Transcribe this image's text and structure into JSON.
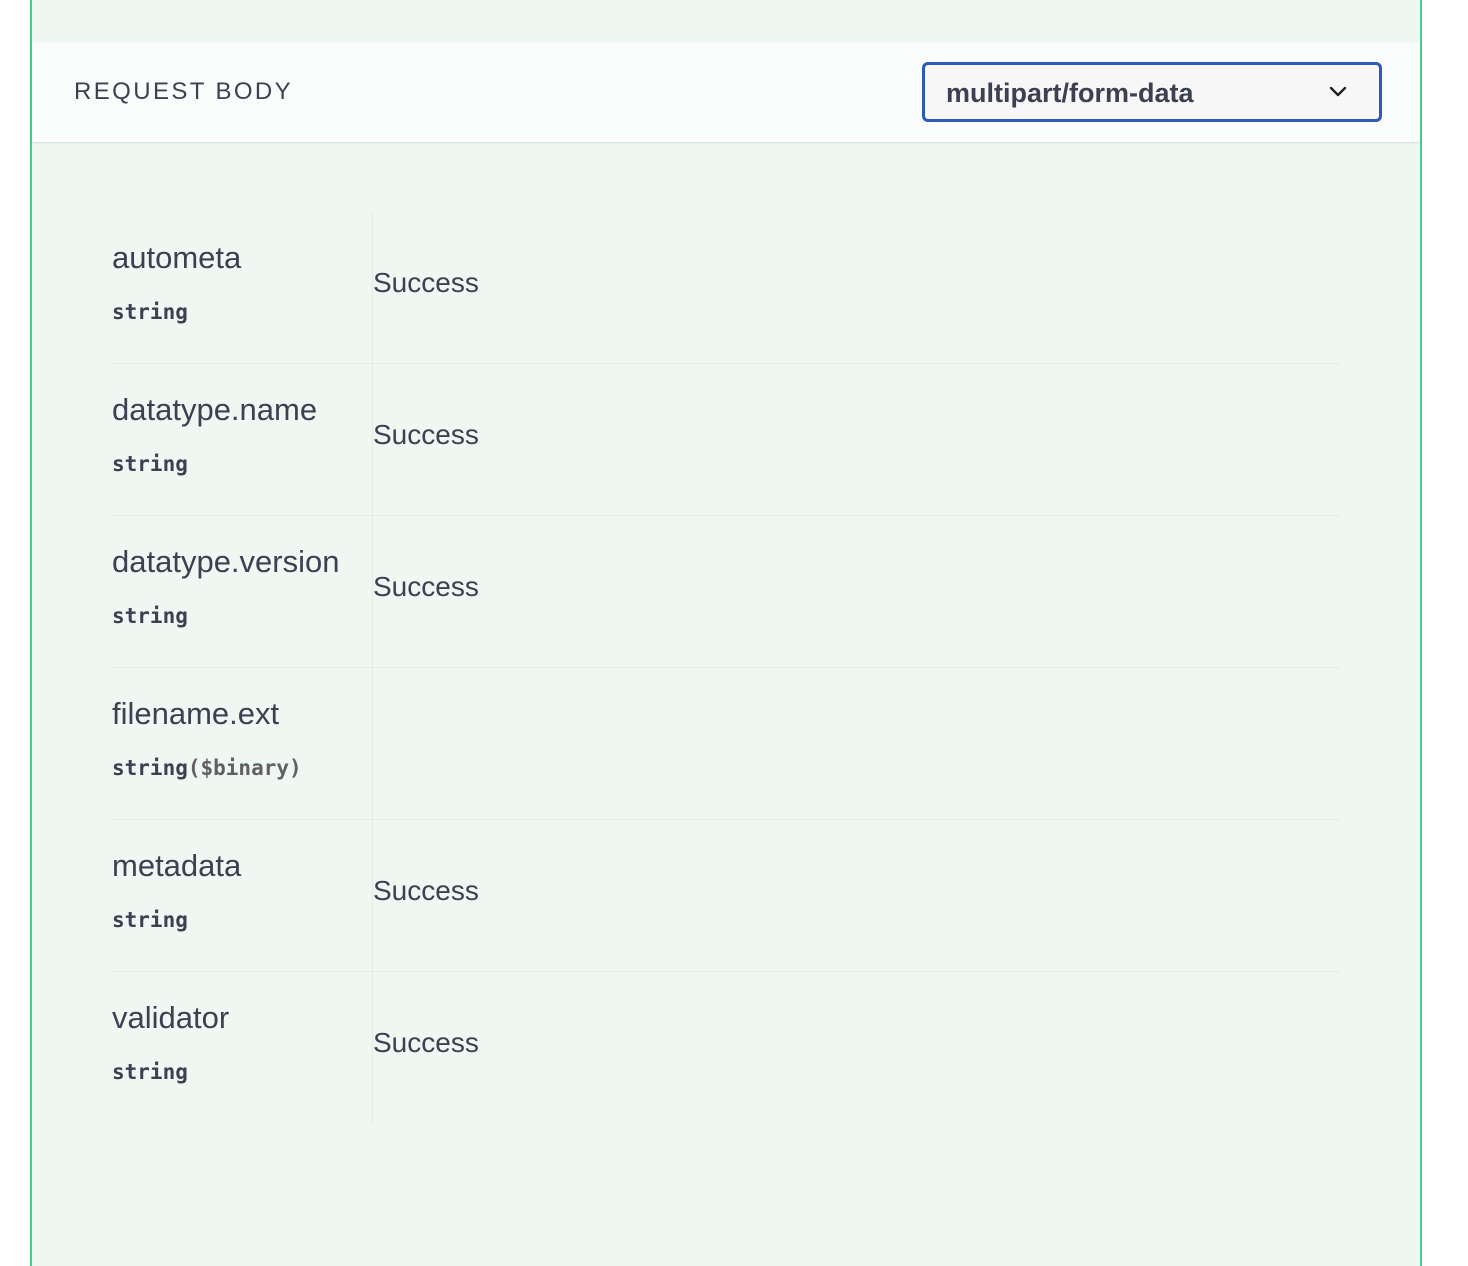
{
  "request_body": {
    "title": "REQUEST BODY",
    "content_type": "multipart/form-data",
    "parameters": [
      {
        "name": "autometa",
        "type": "string",
        "format": "",
        "description": "Success"
      },
      {
        "name": "datatype.name",
        "type": "string",
        "format": "",
        "description": "Success"
      },
      {
        "name": "datatype.version",
        "type": "string",
        "format": "",
        "description": "Success"
      },
      {
        "name": "filename.ext",
        "type": "string",
        "format": "($binary)",
        "description": ""
      },
      {
        "name": "metadata",
        "type": "string",
        "format": "",
        "description": "Success"
      },
      {
        "name": "validator",
        "type": "string",
        "format": "",
        "description": "Success"
      }
    ]
  },
  "colors": {
    "border": "#49cc90",
    "background": "#eff7f3",
    "select_border": "#2e5ab8",
    "text": "#3b4151"
  },
  "icons": {
    "select_chevron": "chevron-down-icon"
  }
}
